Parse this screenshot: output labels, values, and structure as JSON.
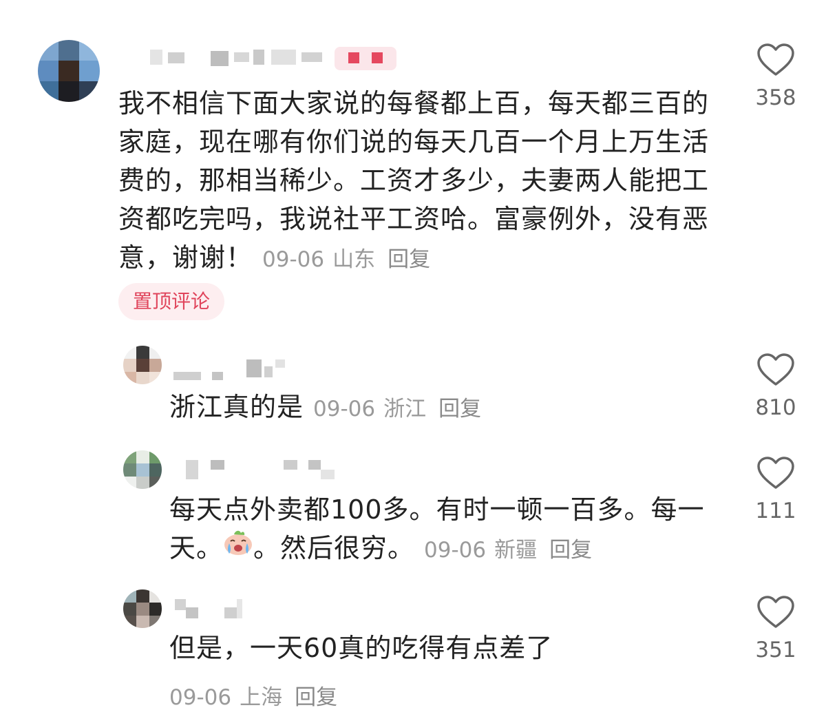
{
  "comments": [
    {
      "text": "我不相信下面大家说的每餐都上百，每天都三百的家庭，现在哪有你们说的每天几百一个月上万生活费的，那相当稀少。工资才多少，夫妻两人能把工资都吃完吗，我说社平工资哈。富豪例外，没有恶意，谢谢！",
      "date": "09-06",
      "region": "山东",
      "reply_label": "回复",
      "pin_label": "置顶评论",
      "like_count": "358"
    },
    {
      "text": "浙江真的是",
      "date": "09-06",
      "region": "浙江",
      "reply_label": "回复",
      "like_count": "810"
    },
    {
      "text_before_emoji": "每天点外卖都100多。有时一顿一百多。每一天。",
      "text_after_emoji": "。然后很穷。",
      "emoji_icon": "crying-face-emoji",
      "date": "09-06",
      "region": "新疆",
      "reply_label": "回复",
      "like_count": "111"
    },
    {
      "text": "但是，一天60真的吃得有点差了",
      "date": "09-06",
      "region": "上海",
      "reply_label": "回复",
      "like_count": "351"
    }
  ],
  "colors": {
    "pin_text": "#e0445b",
    "pin_background": "#fdeef0",
    "meta_text": "#9a9a9a",
    "body_text": "#222222"
  }
}
